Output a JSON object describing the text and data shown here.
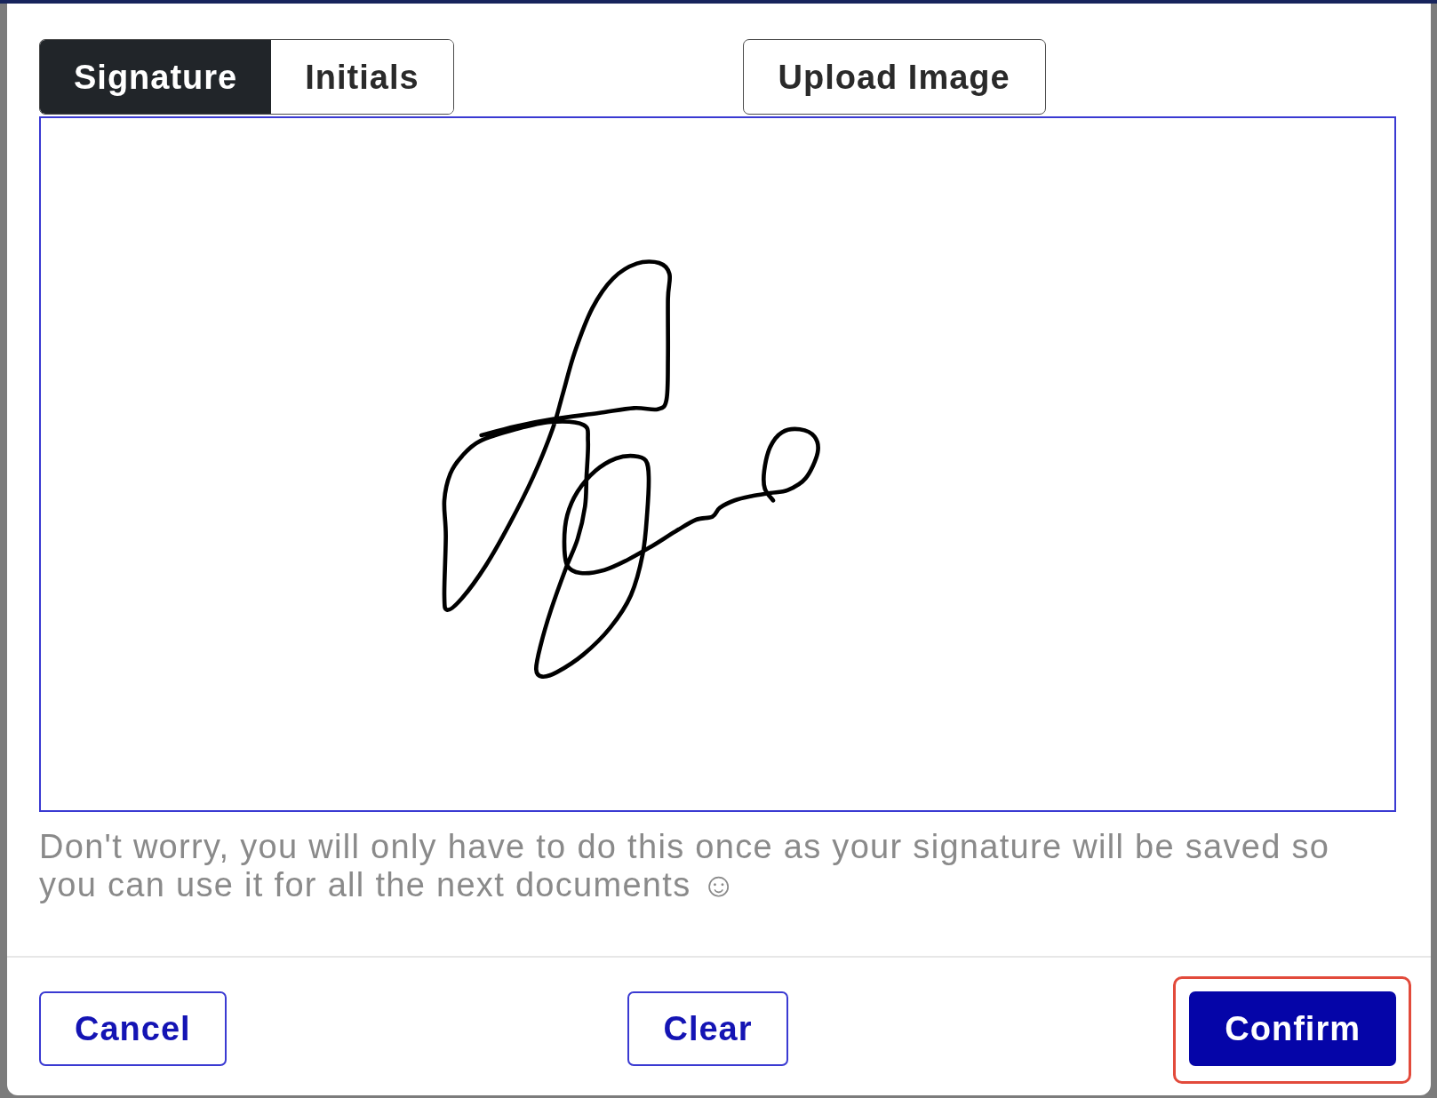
{
  "tabs": [
    {
      "label": "Signature",
      "selected": true
    },
    {
      "label": "Initials",
      "selected": false
    }
  ],
  "upload_button": {
    "label": "Upload Image"
  },
  "hint": "Don't worry, you will only have to do this once as your signature will be saved so you can use it for all the next documents ☺",
  "footer_buttons": [
    {
      "label": "Cancel",
      "kind": "outline",
      "highlighted": false
    },
    {
      "label": "Clear",
      "kind": "outline",
      "highlighted": false
    },
    {
      "label": "Confirm",
      "kind": "primary",
      "highlighted": true
    }
  ]
}
